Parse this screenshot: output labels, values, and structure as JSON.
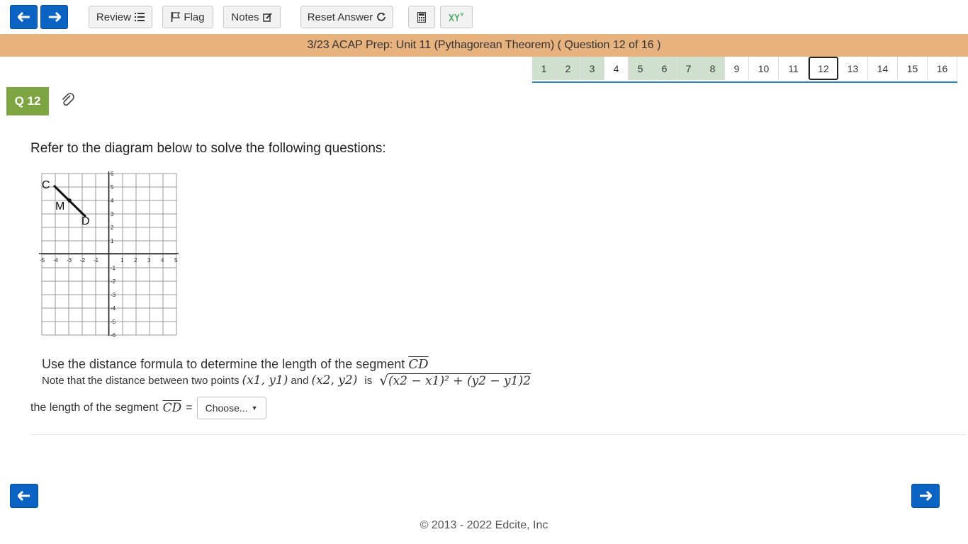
{
  "toolbar": {
    "review_label": "Review",
    "flag_label": "Flag",
    "notes_label": "Notes",
    "reset_label": "Reset Answer"
  },
  "title": "3/23 ACAP Prep: Unit 11 (Pythagorean Theorem) ( Question 12 of 16 )",
  "question_nav": [
    {
      "label": "1",
      "answered": true
    },
    {
      "label": "2",
      "answered": true
    },
    {
      "label": "3",
      "answered": true
    },
    {
      "label": "4",
      "answered": false
    },
    {
      "label": "5",
      "answered": true
    },
    {
      "label": "6",
      "answered": true
    },
    {
      "label": "7",
      "answered": true
    },
    {
      "label": "8",
      "answered": true
    },
    {
      "label": "9",
      "answered": false
    },
    {
      "label": "10",
      "answered": false
    },
    {
      "label": "11",
      "answered": false
    },
    {
      "label": "12",
      "answered": false,
      "current": true
    },
    {
      "label": "13",
      "answered": false
    },
    {
      "label": "14",
      "answered": false
    },
    {
      "label": "15",
      "answered": false
    },
    {
      "label": "16",
      "answered": false
    }
  ],
  "question": {
    "badge": "Q 12",
    "prompt": "Refer to the diagram below to solve the following questions:",
    "instruction": "Use the distance formula to determine the length of the segment",
    "segment": "CD",
    "note_prefix": "Note that the distance between two points",
    "point1": "(x1, y1)",
    "and_word": "and",
    "point2": "(x2, y2)",
    "is_word": "is",
    "formula": "(x2 − x1)² + (y2 − y1)2",
    "answer_label": "the length of the segment",
    "equals": "=",
    "dropdown_value": "Choose..."
  },
  "diagram": {
    "x_ticks": [
      "-5",
      "-4",
      "-3",
      "-2",
      "-1",
      "1",
      "2",
      "3",
      "4",
      "5"
    ],
    "y_ticks": [
      "6",
      "5",
      "4",
      "3",
      "2",
      "1",
      "-1",
      "-2",
      "-3",
      "-4",
      "-5",
      "-6"
    ],
    "point_labels": {
      "c": "C",
      "m": "M",
      "d": "D"
    }
  },
  "footer": "© 2013 - 2022 Edcite, Inc",
  "colors": {
    "accent": "#0b63c4",
    "title_bar": "#e8b27f",
    "badge": "#7ea542",
    "answered": "#cfe0cf"
  }
}
